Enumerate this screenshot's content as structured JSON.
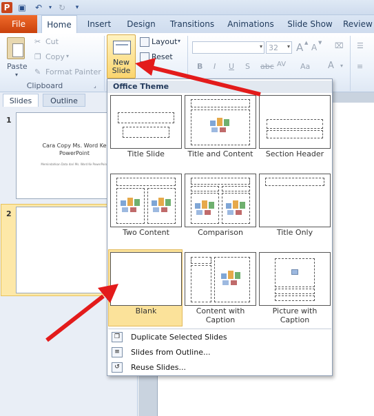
{
  "app": {
    "name": "PowerPoint"
  },
  "qat": {
    "icons": [
      "powerpoint-logo-icon",
      "save-icon",
      "undo-icon",
      "redo-icon",
      "customize-qat-icon"
    ]
  },
  "tabs": {
    "file": "File",
    "items": [
      "Home",
      "Insert",
      "Design",
      "Transitions",
      "Animations",
      "Slide Show",
      "Review"
    ]
  },
  "ribbon": {
    "clipboard": {
      "paste": "Paste",
      "cut": "Cut",
      "copy": "Copy",
      "format_painter": "Format Painter",
      "group_label": "Clipboard"
    },
    "slides": {
      "new_slide_line1": "New",
      "new_slide_line2": "Slide",
      "layout": "Layout",
      "reset": "Reset"
    },
    "font": {
      "size": "32",
      "bold": "B",
      "italic": "I",
      "underline": "U",
      "strike": "S",
      "grow": "A",
      "shrink": "A",
      "char_spacing": "AV",
      "change_case": "Aa",
      "font_color": "A"
    }
  },
  "left_pane": {
    "tabs": [
      "Slides",
      "Outline"
    ],
    "slides": [
      {
        "number": "1",
        "title": "Cara Copy Ms. Word Ke",
        "title2": "PowerPoint",
        "subtitle": "Memindahkan Data dari Ms. Word Ke PowerPoint"
      },
      {
        "number": "2"
      }
    ]
  },
  "menu": {
    "header": "Office Theme",
    "layouts": [
      {
        "name": "Title Slide"
      },
      {
        "name": "Title and Content"
      },
      {
        "name": "Section Header"
      },
      {
        "name": "Two Content"
      },
      {
        "name": "Comparison"
      },
      {
        "name": "Title Only"
      },
      {
        "name": "Blank"
      },
      {
        "name": "Content with",
        "name2": "Caption"
      },
      {
        "name": "Picture with",
        "name2": "Caption"
      }
    ],
    "actions": [
      {
        "label": "Duplicate Selected Slides",
        "icon": "duplicate-slides-icon"
      },
      {
        "label": "Slides from Outline...",
        "icon": "slides-from-outline-icon"
      },
      {
        "label": "Reuse Slides...",
        "icon": "reuse-slides-icon"
      }
    ]
  },
  "colors": {
    "file_tab": "#e2571e",
    "annotation_arrow": "#e31b1b",
    "selected_highlight": "#fbe29a"
  }
}
